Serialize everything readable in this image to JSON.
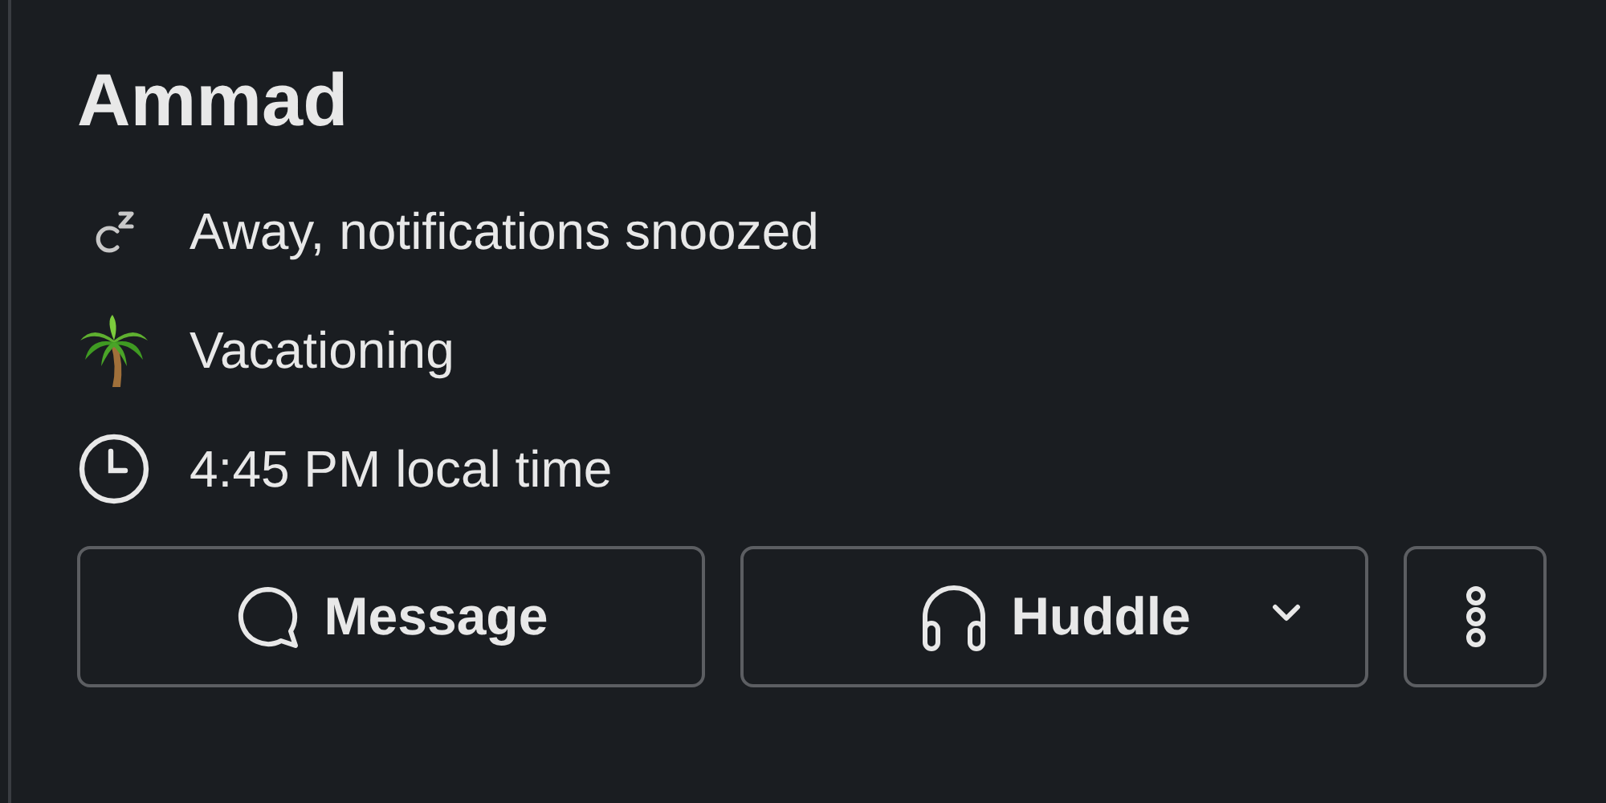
{
  "profile": {
    "name": "Ammad",
    "details": [
      {
        "kind": "snooze",
        "text": "Away, notifications snoozed"
      },
      {
        "kind": "palm",
        "text": "Vacationing"
      },
      {
        "kind": "clock",
        "text": "4:45 PM local time"
      }
    ],
    "buttons": [
      {
        "kind": "message",
        "label": "Message"
      },
      {
        "kind": "huddle",
        "label": "Huddle"
      },
      {
        "kind": "more"
      }
    ]
  }
}
